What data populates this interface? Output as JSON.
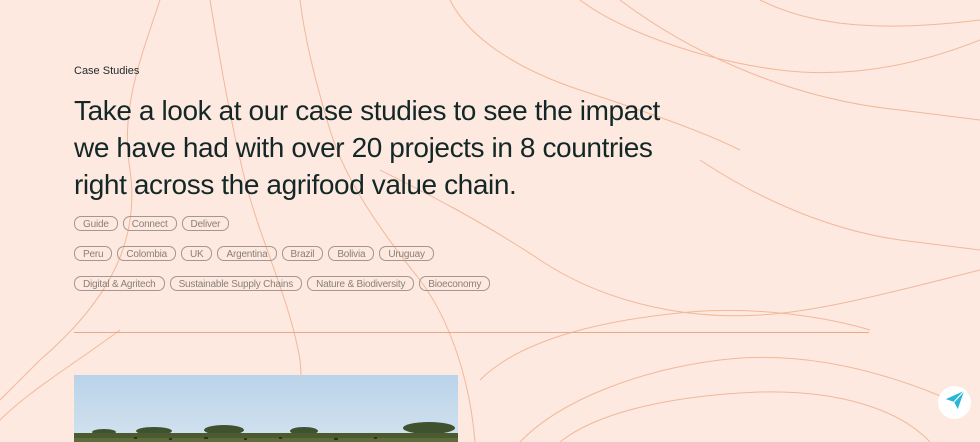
{
  "header": {
    "eyebrow": "Case Studies",
    "headline": "Take a look at our case studies to see the impact we have had with over 20 projects in 8 countries right across the agrifood value chain."
  },
  "filters": {
    "services": [
      "Guide",
      "Connect",
      "Deliver"
    ],
    "countries": [
      "Peru",
      "Colombia",
      "UK",
      "Argentina",
      "Brazil",
      "Bolivia",
      "Uruguay"
    ],
    "themes": [
      "Digital & Agritech",
      "Sustainable Supply Chains",
      "Nature & Biodiversity",
      "Bioeconomy"
    ]
  },
  "colors": {
    "background": "#fde9e0",
    "contour": "#f1b89a",
    "divider": "#e8a98a",
    "send_icon": "#2ab7d6"
  },
  "icons": {
    "send": "paper-plane-icon"
  }
}
